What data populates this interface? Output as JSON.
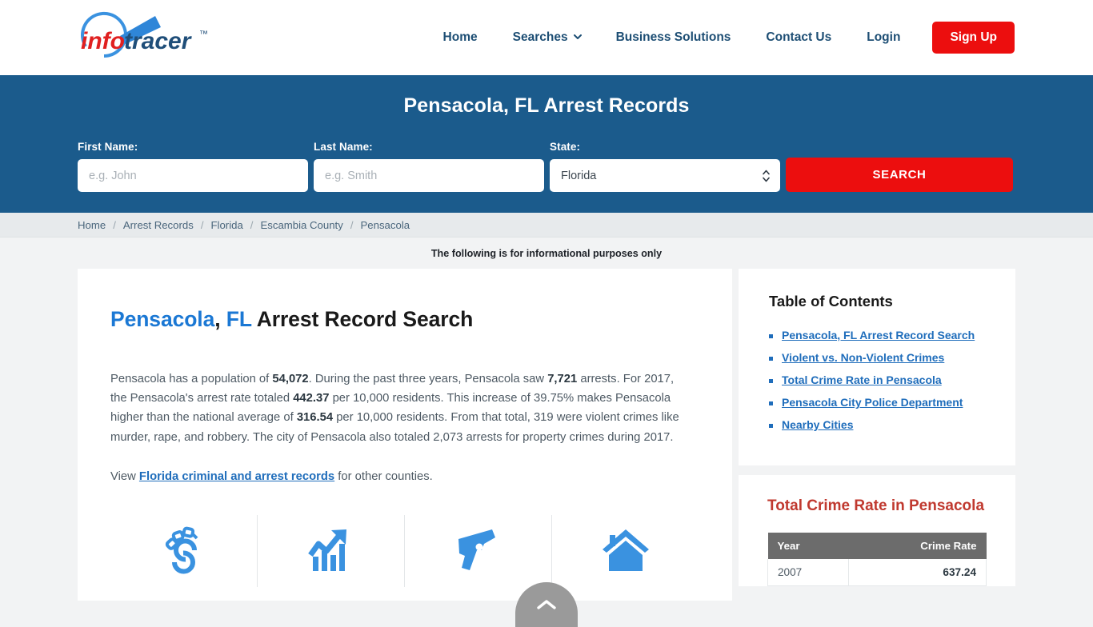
{
  "brand": {
    "logo_text_info": "info",
    "logo_text_tracer": "tracer",
    "logo_tm": "™",
    "colors": {
      "red": "#ec0e0e",
      "hero_blue": "#1b5b8c",
      "link_blue": "#1f6dbb",
      "icon_blue": "#3a92e0",
      "heading_red": "#c0392f",
      "table_header_gray": "#6c6c6c"
    }
  },
  "nav": {
    "items": [
      {
        "label": "Home",
        "has_dropdown": false
      },
      {
        "label": "Searches",
        "has_dropdown": true
      },
      {
        "label": "Business Solutions",
        "has_dropdown": false
      },
      {
        "label": "Contact Us",
        "has_dropdown": false
      },
      {
        "label": "Login",
        "has_dropdown": false
      }
    ],
    "signup_label": "Sign Up"
  },
  "hero": {
    "title": "Pensacola, FL Arrest Records",
    "first_name_label": "First Name:",
    "first_name_placeholder": "e.g. John",
    "first_name_value": "",
    "last_name_label": "Last Name:",
    "last_name_placeholder": "e.g. Smith",
    "last_name_value": "",
    "state_label": "State:",
    "state_selected": "Florida",
    "state_options": [
      "Florida"
    ],
    "search_button": "SEARCH"
  },
  "breadcrumb": {
    "items": [
      "Home",
      "Arrest Records",
      "Florida",
      "Escambia County",
      "Pensacola"
    ],
    "separator": "/"
  },
  "notice": "The following is for informational purposes only",
  "main": {
    "heading_city": "Pensacola",
    "heading_comma": ",",
    "heading_state": "FL",
    "heading_rest": "Arrest Record Search",
    "paragraph_parts": [
      {
        "t": "Pensacola has a population of ",
        "b": false
      },
      {
        "t": "54,072",
        "b": true
      },
      {
        "t": ". During the past three years, Pensacola saw ",
        "b": false
      },
      {
        "t": "7,721",
        "b": true
      },
      {
        "t": " arrests. For 2017, the Pensacola's arrest rate totaled ",
        "b": false
      },
      {
        "t": "442.37",
        "b": true
      },
      {
        "t": " per 10,000 residents. This increase of 39.75% makes Pensacola higher than the national average of ",
        "b": false
      },
      {
        "t": "316.54",
        "b": true
      },
      {
        "t": " per 10,000 residents. From that total, 319 were violent crimes like murder, rape, and robbery. The city of Pensacola also totaled 2,073 arrests for property crimes during 2017.",
        "b": false
      }
    ],
    "view_prefix": "View ",
    "view_link": "Florida criminal and arrest records",
    "view_suffix": " for other counties.",
    "icons": [
      {
        "name": "handcuffs-icon"
      },
      {
        "name": "trending-up-chart-icon"
      },
      {
        "name": "handgun-icon"
      },
      {
        "name": "house-icon"
      }
    ]
  },
  "sidebar": {
    "toc_title": "Table of Contents",
    "toc_items": [
      "Pensacola, FL Arrest Record Search",
      "Violent vs. Non-Violent Crimes",
      "Total Crime Rate in Pensacola",
      "Pensacola City Police Department",
      "Nearby Cities"
    ],
    "crime_title": "Total Crime Rate in Pensacola",
    "crime_table": {
      "columns": [
        "Year",
        "Crime Rate"
      ],
      "rows": [
        {
          "year": "2007",
          "rate": "637.24"
        }
      ]
    }
  },
  "scroll_top": {
    "name": "scroll-to-top-button"
  }
}
